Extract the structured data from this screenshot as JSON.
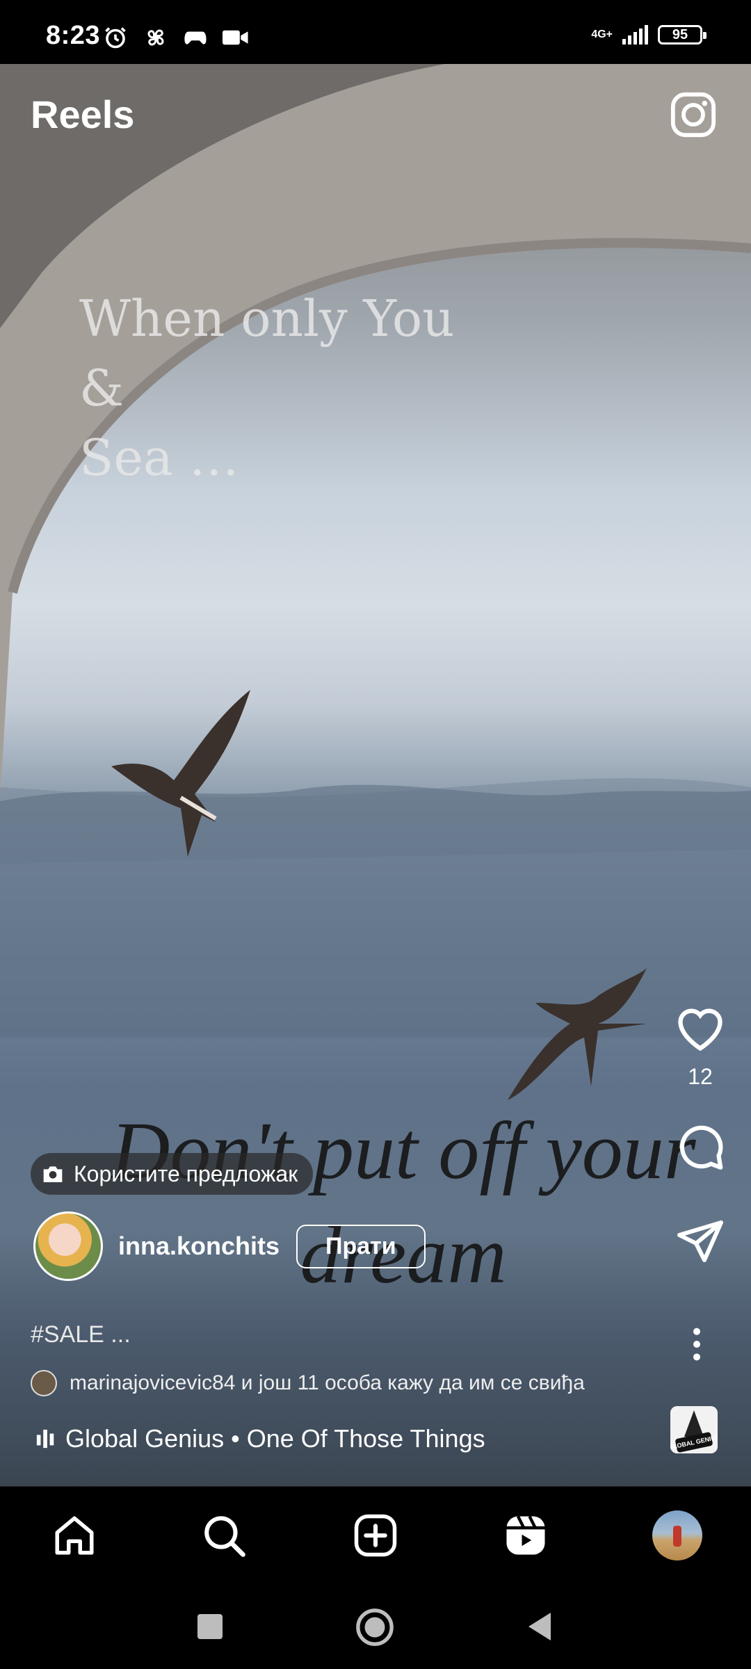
{
  "status_bar": {
    "time": "8:23",
    "network": "4G+",
    "battery": "95"
  },
  "header": {
    "title": "Reels"
  },
  "video_overlay": {
    "top_text": "When only You\n&\nSea …",
    "bottom_text": "Don't put off your dream"
  },
  "actions": {
    "like_count": "12"
  },
  "template_pill": {
    "label": "Користите предложак"
  },
  "author": {
    "username": "inna.konchits",
    "follow_label": "Прати"
  },
  "caption": "#SALE ...",
  "likes_text": "marinajovicevic84 и још 11 особа кажу да им се свиђа",
  "music": {
    "text": "Global Genius • One Of Those Things",
    "album_text": "GLOBAL GENIUS"
  },
  "bottom_nav": [
    "home",
    "search",
    "create",
    "reels",
    "profile"
  ]
}
